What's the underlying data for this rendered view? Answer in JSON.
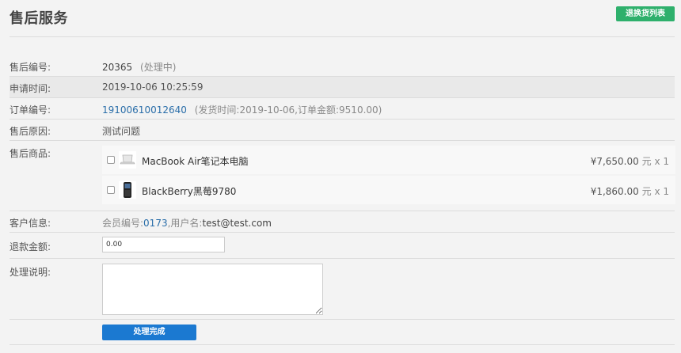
{
  "header": {
    "title": "售后服务",
    "list_button": "退换货列表"
  },
  "fields": {
    "service_no": {
      "label": "售后编号:",
      "value": "20365",
      "status": "(处理中)"
    },
    "apply_time": {
      "label": "申请时间:",
      "value": "2019-10-06 10:25:59"
    },
    "order_no": {
      "label": "订单编号:",
      "value": "19100610012640",
      "detail": "(发货时间:2019-10-06,订单金额:9510.00)"
    },
    "reason": {
      "label": "售后原因:",
      "value": "测试问题"
    },
    "products_label": "售后商品:",
    "customer": {
      "label": "客户信息:",
      "member_prefix": "会员编号:",
      "member_no": "0173",
      "username_prefix": ",用户名:",
      "username": "test@test.com"
    },
    "refund": {
      "label": "退款金额:",
      "value": "0.00"
    },
    "note": {
      "label": "处理说明:",
      "value": ""
    }
  },
  "products": [
    {
      "name": "MacBook Air笔记本电脑",
      "price": "¥7,650.00",
      "unit": "元",
      "qty": "x 1",
      "icon": "laptop-icon"
    },
    {
      "name": "BlackBerry黑莓9780",
      "price": "¥1,860.00",
      "unit": "元",
      "qty": "x 1",
      "icon": "phone-icon"
    }
  ],
  "actions": {
    "submit": "处理完成"
  },
  "colors": {
    "primary": "#1b79d1",
    "success": "#2eb06c",
    "link": "#2a6ea9"
  }
}
